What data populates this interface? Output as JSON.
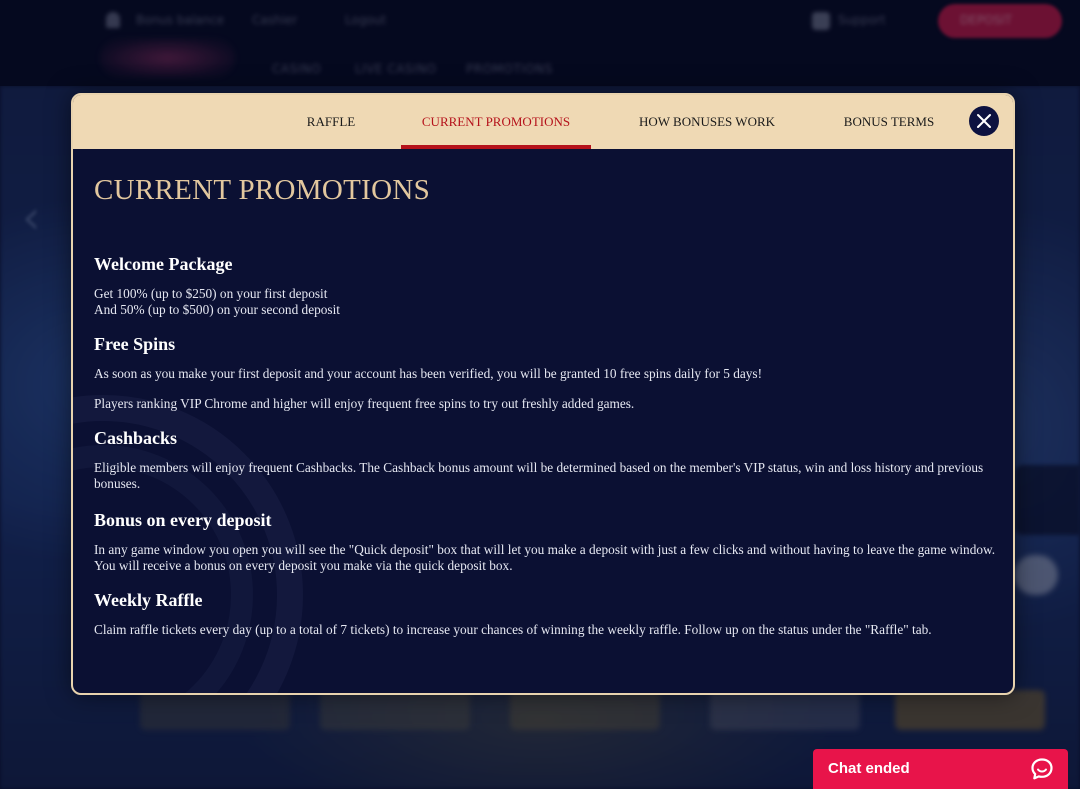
{
  "background": {
    "top_links": [
      "Bonus balance",
      "Cashier",
      "Logout"
    ],
    "nav_items": [
      "CASINO",
      "LIVE CASINO",
      "PROMOTIONS"
    ],
    "cta_label": "DEPOSIT",
    "support_label": "Support"
  },
  "modal": {
    "tabs": [
      {
        "label": "RAFFLE",
        "active": false
      },
      {
        "label": "CURRENT PROMOTIONS",
        "active": true
      },
      {
        "label": "HOW BONUSES WORK",
        "active": false
      },
      {
        "label": "BONUS TERMS",
        "active": false
      }
    ],
    "close_icon": "close-icon",
    "title": "CURRENT PROMOTIONS",
    "sections": {
      "welcome": {
        "heading": "Welcome Package",
        "line1": "Get 100% (up to $250) on your first deposit",
        "line2": "And 50% (up to $500) on your second deposit"
      },
      "free_spins": {
        "heading": "Free Spins",
        "p1": "As soon as you make your first deposit and your account has been verified, you will be granted 10 free spins daily for 5 days!",
        "p2": "Players ranking VIP Chrome and higher will enjoy frequent free spins to try out freshly added games."
      },
      "cashbacks": {
        "heading": "Cashbacks",
        "p1": "Eligible members will enjoy frequent Cashbacks. The Cashback bonus amount will be determined based on the member's VIP status, win and loss history and previous bonuses."
      },
      "bonus_deposit": {
        "heading": "Bonus on every deposit",
        "p1": "In any game window you open you will see the \"Quick deposit\" box that will let you make a deposit with just a few clicks and without having to leave the game window. You will receive a bonus on every deposit you make via the quick deposit box."
      },
      "weekly_raffle": {
        "heading": "Weekly Raffle",
        "p1": "Claim raffle tickets every day (up to a total of 7 tickets) to increase your chances of winning the weekly raffle. Follow up on the status under the \"Raffle\" tab."
      }
    }
  },
  "chat": {
    "label": "Chat ended",
    "icon": "chat-bubble-icon"
  },
  "colors": {
    "accent_red": "#b5121b",
    "title_gold": "#e2c79e",
    "tab_bar": "#efd9b4",
    "modal_bg": "#0b1033",
    "chat_bg": "#e8144a"
  }
}
